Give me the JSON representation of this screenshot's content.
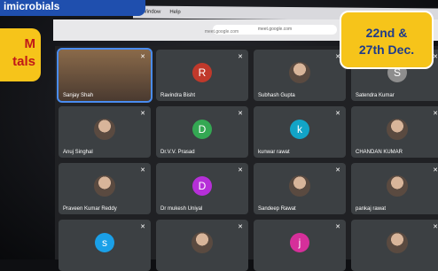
{
  "banner": {
    "top_text": "imicrobials",
    "left_line1": "M",
    "left_line2": "tals"
  },
  "event": {
    "date_line1": "22nd &",
    "date_line2": "27th Dec."
  },
  "menubar": {
    "items": [
      "Window",
      "Help"
    ]
  },
  "browser": {
    "url": "meet.google.com",
    "url_sub": "meet.google.com"
  },
  "participants": [
    {
      "name": "Sanjay Shah",
      "type": "video",
      "color": "#6b5a4e"
    },
    {
      "name": "Ravindra Bisht",
      "type": "initial",
      "initial": "R",
      "color": "#c0392b"
    },
    {
      "name": "Subhash Gupta",
      "type": "photo",
      "color": "#8aa0b0"
    },
    {
      "name": "Satendra Kumar",
      "type": "initial",
      "initial": "S",
      "color": "#8e8e8e"
    },
    {
      "name": "Anuj Singhal",
      "type": "photo",
      "color": "#b0a090"
    },
    {
      "name": "Dr.V.V. Prasad",
      "type": "initial",
      "initial": "D",
      "color": "#34a853"
    },
    {
      "name": "kunwar rawat",
      "type": "initial",
      "initial": "k",
      "color": "#12a4c7"
    },
    {
      "name": "CHANDAN KUMAR",
      "type": "photo",
      "color": "#7a6a5a"
    },
    {
      "name": "Praveen Kumar Reddy",
      "type": "photo",
      "color": "#a08070"
    },
    {
      "name": "Dr mukesh Uniyal",
      "type": "initial",
      "initial": "D",
      "color": "#b62fd8"
    },
    {
      "name": "Sandeep Rawat",
      "type": "photo",
      "color": "#9a8a80"
    },
    {
      "name": "pankaj rawat",
      "type": "photo",
      "color": "#6a6a6a"
    },
    {
      "name": "",
      "type": "initial",
      "initial": "s",
      "color": "#1aa0e8"
    },
    {
      "name": "",
      "type": "photo",
      "color": "#c8c8c0"
    },
    {
      "name": "",
      "type": "initial",
      "initial": "j",
      "color": "#d62f9a"
    },
    {
      "name": "",
      "type": "photo",
      "color": "#8a7a6a"
    }
  ],
  "colors": {
    "badge_yellow": "#f6c41a",
    "banner_blue": "#1f4fae",
    "meet_bg": "#202124",
    "tile_bg": "#3c4043"
  }
}
